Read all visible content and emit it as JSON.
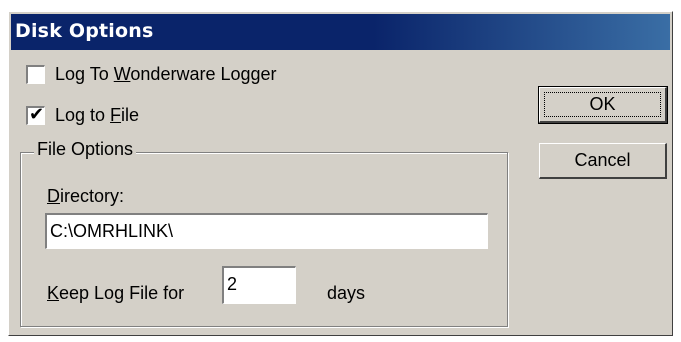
{
  "dialog": {
    "title": "Disk Options"
  },
  "options": {
    "log_to_logger": {
      "label_pre": "Log To ",
      "label_ul": "W",
      "label_post": "onderware Logger",
      "checked": false
    },
    "log_to_file": {
      "label_pre": "Log to ",
      "label_ul": "F",
      "label_post": "ile",
      "checked": true
    }
  },
  "file_options": {
    "legend": "File Options",
    "directory_label_ul": "D",
    "directory_label_post": "irectory:",
    "directory_value": "C:\\OMRHLINK\\",
    "keep_label_ul": "K",
    "keep_label_post": "eep Log File for",
    "keep_value": "2",
    "days_label": "days"
  },
  "buttons": {
    "ok": "OK",
    "cancel": "Cancel"
  },
  "colors": {
    "titlebar": "#0a246a",
    "face": "#d4d0c8"
  }
}
